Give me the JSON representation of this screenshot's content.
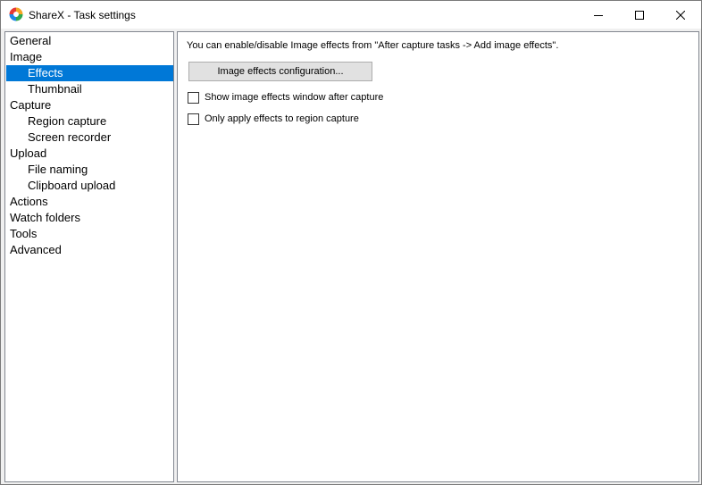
{
  "window": {
    "title": "ShareX - Task settings",
    "controls": {
      "minimize": "minimize-icon",
      "maximize": "maximize-icon",
      "close": "close-icon"
    }
  },
  "tree": {
    "items": [
      {
        "label": "General",
        "level": 0,
        "selected": false
      },
      {
        "label": "Image",
        "level": 0,
        "selected": false
      },
      {
        "label": "Effects",
        "level": 1,
        "selected": true
      },
      {
        "label": "Thumbnail",
        "level": 1,
        "selected": false
      },
      {
        "label": "Capture",
        "level": 0,
        "selected": false
      },
      {
        "label": "Region capture",
        "level": 1,
        "selected": false
      },
      {
        "label": "Screen recorder",
        "level": 1,
        "selected": false
      },
      {
        "label": "Upload",
        "level": 0,
        "selected": false
      },
      {
        "label": "File naming",
        "level": 1,
        "selected": false
      },
      {
        "label": "Clipboard upload",
        "level": 1,
        "selected": false
      },
      {
        "label": "Actions",
        "level": 0,
        "selected": false
      },
      {
        "label": "Watch folders",
        "level": 0,
        "selected": false
      },
      {
        "label": "Tools",
        "level": 0,
        "selected": false
      },
      {
        "label": "Advanced",
        "level": 0,
        "selected": false
      }
    ]
  },
  "panel": {
    "info_text": "You can enable/disable Image effects from \"After capture tasks -> Add image effects\".",
    "config_button": "Image effects configuration...",
    "checkboxes": [
      {
        "label": "Show image effects window after capture",
        "checked": false
      },
      {
        "label": "Only apply effects to region capture",
        "checked": false
      }
    ]
  },
  "colors": {
    "selection": "#0078d7",
    "border": "#828790",
    "window_bg": "#f0f0f0"
  }
}
